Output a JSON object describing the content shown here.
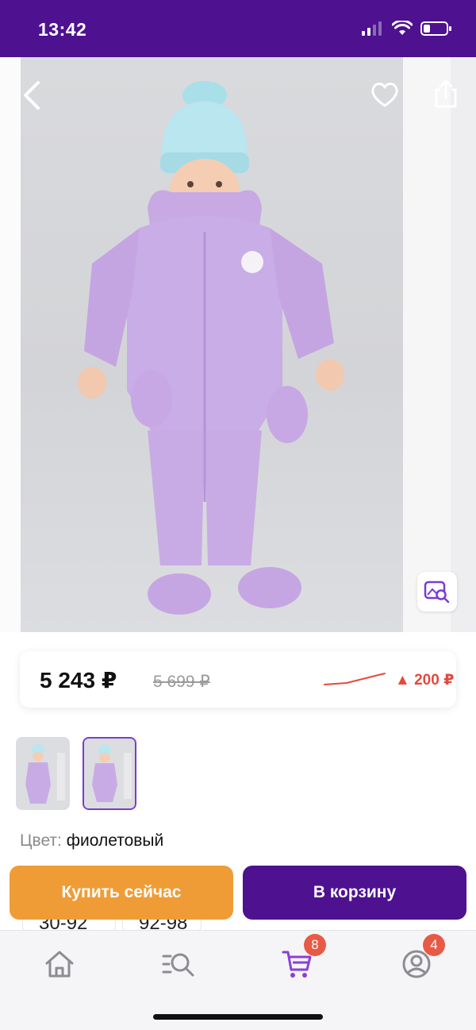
{
  "status_bar": {
    "time": "13:42"
  },
  "product": {
    "image_alt": "Детский зимний комбинезон фиолетовый",
    "price": "5 243 ₽",
    "old_price": "5 699 ₽",
    "price_change": "▲ 200 ₽",
    "color_label": "Цвет:",
    "color_value": "фиолетовый",
    "thumbnails": [
      {
        "selected": false
      },
      {
        "selected": true
      }
    ]
  },
  "size_peek": [
    "30-92",
    "92-98"
  ],
  "actions": {
    "buy_now": "Купить сейчас",
    "add_to_cart": "В корзину"
  },
  "tabbar": {
    "items": [
      {
        "icon": "home-icon"
      },
      {
        "icon": "catalog-search-icon"
      },
      {
        "icon": "cart-icon",
        "badge": "8"
      },
      {
        "icon": "profile-icon",
        "badge": "4"
      }
    ]
  },
  "colors": {
    "brand": "#4e1190",
    "accent_orange": "#f09c36",
    "price_up": "#e4493f",
    "tab_active": "#8b3fd6"
  }
}
